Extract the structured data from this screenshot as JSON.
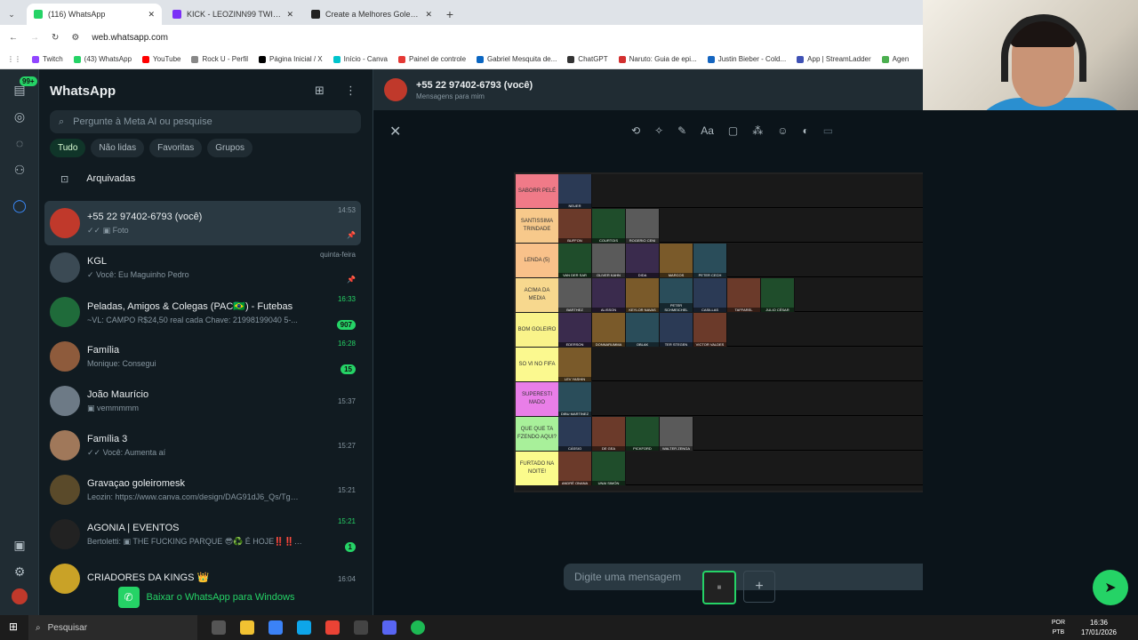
{
  "browser": {
    "tabs": [
      {
        "title": "(116) WhatsApp",
        "color": "#25d366"
      },
      {
        "title": "KICK - LEOZINN99 TWITCH - L",
        "color": "#7b2ff7"
      },
      {
        "title": "Create a Melhores Goleiros Tie",
        "color": "#222222"
      }
    ],
    "url": "web.whatsapp.com",
    "bookmarks": [
      {
        "label": "Twitch",
        "color": "#9146ff"
      },
      {
        "label": "(43) WhatsApp",
        "color": "#25d366"
      },
      {
        "label": "YouTube",
        "color": "#ff0000"
      },
      {
        "label": "Rock U - Perfil",
        "color": "#888888"
      },
      {
        "label": "Página Inicial / X",
        "color": "#000000"
      },
      {
        "label": "Início - Canva",
        "color": "#00c4cc"
      },
      {
        "label": "Painel de controle",
        "color": "#e53935"
      },
      {
        "label": "Gabriel Mesquita de...",
        "color": "#0a66c2"
      },
      {
        "label": "ChatGPT",
        "color": "#333333"
      },
      {
        "label": "Naruto: Guia de epi...",
        "color": "#d32f2f"
      },
      {
        "label": "Justin Bieber - Cold...",
        "color": "#1565c0"
      },
      {
        "label": "App | StreamLadder",
        "color": "#3f51b5"
      },
      {
        "label": "Agen",
        "color": "#4caf50"
      }
    ]
  },
  "whatsapp": {
    "title": "WhatsApp",
    "unread_badge": "99+",
    "search_placeholder": "Pergunte à Meta AI ou pesquise",
    "filters": [
      "Tudo",
      "Não lidas",
      "Favoritas",
      "Grupos"
    ],
    "archived_label": "Arquivadas",
    "download_label": "Baixar o WhatsApp para Windows",
    "chats": [
      {
        "name": "+55 22 97402-6793 (você)",
        "msg": "✓✓ ▣ Foto",
        "time": "14:53",
        "extra": "📌",
        "avatar": "#c0392b"
      },
      {
        "name": "KGL",
        "msg": "✓ Você: Eu  Maguinho Pedro",
        "time": "quinta-feira",
        "extra": "📌",
        "avatar": "#3b4a54"
      },
      {
        "name": "Peladas, Amigos & Colegas (PAC🇧🇷) - Futebas",
        "msg": "~VL: CAMPO  R$24,50 real cada  Chave: 21998199040 5-...",
        "time": "16:33",
        "extra": "907",
        "avatar": "#1f6b3a"
      },
      {
        "name": "Família",
        "msg": "Monique: Consegui",
        "time": "16:28",
        "extra": "15",
        "avatar": "#8e5b3c"
      },
      {
        "name": "João Maurício",
        "msg": "▣ vemmmmm",
        "time": "15:37",
        "extra": "",
        "avatar": "#6d7a86"
      },
      {
        "name": "Família 3",
        "msg": "✓✓ Você: Aumenta aí",
        "time": "15:27",
        "extra": "",
        "avatar": "#a0785a"
      },
      {
        "name": "Gravaçao goleiromesk",
        "msg": "Leozin: https://www.canva.com/design/DAG91dJ6_Qs/TguV71N...",
        "time": "15:21",
        "extra": "",
        "avatar": "#5a4a2a"
      },
      {
        "name": "AGONIA | EVENTOS",
        "msg": "Bertoletti: ▣ THE FUCKING PARQUE 😎♻️ É HOJE‼️‼️ ...",
        "time": "15:21",
        "extra": "1",
        "avatar": "#222222"
      },
      {
        "name": "CRIADORES DA KINGS 👑",
        "msg": "",
        "time": "16:04",
        "extra": "",
        "avatar": "#c9a227"
      }
    ],
    "chat_header": {
      "name": "+55 22 97402-6793 (você)",
      "subtitle": "Mensagens para mim"
    },
    "message_placeholder": "Digite uma mensagem"
  },
  "tierlist": {
    "tiers": [
      {
        "label": "SABORR PELÉ",
        "color": "#f07a88",
        "players": [
          "NEUER"
        ]
      },
      {
        "label": "SANTISSIMA TRINDADE",
        "color": "#f7c98b",
        "players": [
          "BUFFON",
          "COURTOIS",
          "ROGERIO CENI"
        ]
      },
      {
        "label": "LENDA (5)",
        "color": "#f9c18a",
        "players": [
          "VAN DER SAR",
          "OLIVER KAHN",
          "DIDA",
          "MARCOS",
          "PETER CECH"
        ]
      },
      {
        "label": "ACIMA DA MEDIA",
        "color": "#f7d88e",
        "players": [
          "BARTHEZ",
          "ALISSON",
          "KEYLOR NAVAS",
          "PETER SCHMEICHEL",
          "CASILLAS",
          "TAFFAREL",
          "JULIO CÉSAR"
        ]
      },
      {
        "label": "BOM GOLEIRO",
        "color": "#f9f38a",
        "players": [
          "EDERSON",
          "DONNARUMMA",
          "OBLAK",
          "TER STEGEN",
          "VICTOR VALDES"
        ]
      },
      {
        "label": "SO VI NO FIFA",
        "color": "#fbf98f",
        "players": [
          "LEV YASHIN"
        ]
      },
      {
        "label": "SUPERESTI MADO",
        "color": "#e97ee8",
        "players": [
          "DIBU MARTINEZ"
        ]
      },
      {
        "label": "QUE QUE TA FZENDO AQUI?",
        "color": "#a8f09a",
        "players": [
          "CÁSSIO",
          "DE GEA",
          "PICKFORD",
          "WALTER ZENGA"
        ]
      },
      {
        "label": "FURTADO NA NOITE!",
        "color": "#fbfb8c",
        "players": [
          "ANDRÉ ONANA",
          "UNAI SIMÓN"
        ]
      }
    ]
  },
  "taskbar": {
    "search": "Pesquisar",
    "lang1": "POR",
    "lang2": "PTB",
    "time": "16:36",
    "date": "17/01/2026"
  }
}
